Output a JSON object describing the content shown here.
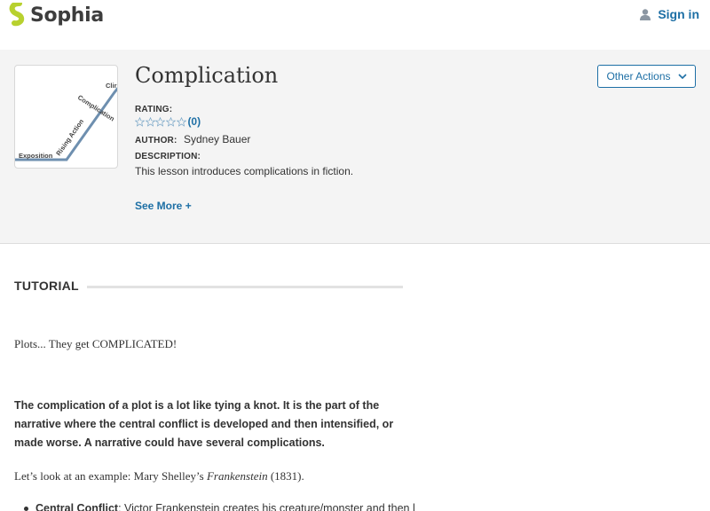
{
  "brand": {
    "name": "Sophia",
    "accent": "#b8d12f"
  },
  "header": {
    "signin_label": "Sign in"
  },
  "lesson": {
    "title": "Complication",
    "thumbnail": {
      "labels": [
        "Exposition",
        "Rising Action",
        "Complication",
        "Clir"
      ]
    },
    "rating_label": "RATING:",
    "rating_count": "(0)",
    "rating_value": 0,
    "rating_max": 5,
    "author_label": "AUTHOR:",
    "author_name": "Sydney Bauer",
    "description_label": "DESCRIPTION:",
    "description": "This lesson introduces complications in fiction.",
    "see_more": "See More +",
    "other_actions": "Other Actions"
  },
  "tutorial": {
    "heading": "TUTORIAL",
    "intro": "Plots... They get COMPLICATED!",
    "definition": "The complication of a plot is a lot like tying a knot. It is the part of the narrative where the central conflict is developed and then intensified, or made worse. A narrative could have several complications.",
    "example_prefix": "Let’s look at an example: Mary Shelley’s ",
    "example_title": "Frankenstein",
    "example_suffix": " (1831).",
    "bullet_label": "Central Conflict",
    "bullet_text": ": Victor Frankenstein creates his creature/monster and then loses"
  },
  "colors": {
    "link": "#1d6fa5",
    "banner_bg": "#f4f4f4",
    "text": "#333333"
  }
}
